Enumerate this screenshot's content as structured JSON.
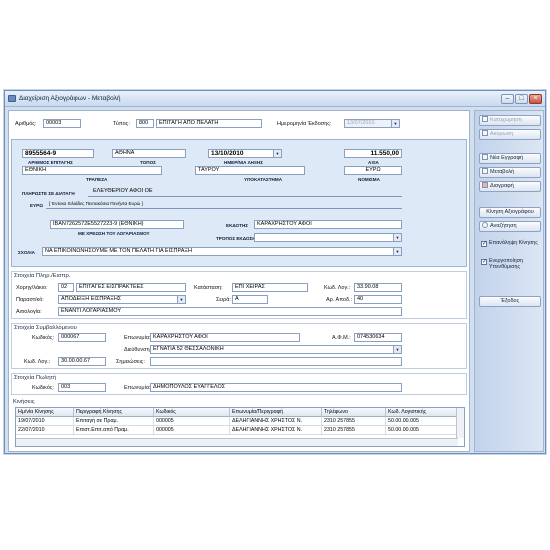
{
  "window": {
    "title": "Διαχείριση Αξιογράφων - Μεταβολή"
  },
  "header": {
    "arithmos_label": "Αριθμός:",
    "arithmos_value": "00003",
    "typos_label": "Τύπος:",
    "typos_code": "800",
    "typos_value": "ΕΠΙΤΑΓΗ ΑΠΟ ΠΕΛΑΤΗ",
    "hmeromhnia_label": "Ημερομηνία Έκδοσης:",
    "hmeromhnia_value": "13/07/2010"
  },
  "cheque": {
    "arithmos_epitaghs": "8955564-9",
    "arithmos_epitaghs_cap": "ΑΡΙΘΜΟΣ ΕΠΙΤΑΓΗΣ",
    "topos": "ΑΘΗΝΑ",
    "topos_cap": "ΤΟΠΟΣ",
    "hmeromhnia_lhxhs": "13/10/2010",
    "hmeromhnia_cap": "ΗΜΕΡ/ΝΙΑ ΛΗΞΗΣ",
    "axia": "11.550,00",
    "axia_cap": "ΑΞΙΑ",
    "trapeza": "ΕΘΝΙΚΗ",
    "trapeza_cap": "ΤΡΑΠΕΖΑ",
    "ypokatasthma": "ΤΑΥΡΟΥ",
    "ypokatasthma_cap": "ΥΠΟΚΑΤΑΣΤΗΜΑ",
    "nomisma": "ΕΥΡΩ",
    "nomisma_cap": "ΝΟΜΙΣΜΑ",
    "plhrwste_cap": "ΠΛΗΡΩΣΤΕ ΣΕ ΔΙΑΤΑΓΗ",
    "plhrwste_value": "ΕΛΕΥΘΕΡΙΟΥ ΑΦΟΙ ΟΕ",
    "eurw_cap": "ΕΥΡΩ",
    "eurw_value": "[ Έντεκα Χιλιάδες Πεντακόσια Πενήντα Ευρώ ]",
    "iban": "IBAN7262572E5527223-9 (ΕΘΝΙΚΗ)",
    "iban_cap": "ΜΕ ΧΡΕΩΣΗ ΤΟΥ ΛΟΓΑΡΙΑΣΜΟΥ",
    "ekdoths_cap": "ΕΚΔΟΤΗΣ",
    "ekdoths_value": "ΚΑΡΑΧΡΗΣΤΟΥ ΑΦΟΙ",
    "tropos_cap": "ΤΡΟΠΟΣ ΕΚΔΟΣΗΣ",
    "tropos_value": "",
    "sxolia_cap": "ΣΧΟΛΙΑ",
    "sxolia_value": "ΝΑ ΕΠΙΚΟΙΝΩΝΗΣΟΥΜΕ ΜΕ ΤΟΝ ΠΕΛΑΤΗ ΓΙΑ ΕΙΣΠΡΑΞΗ"
  },
  "payment": {
    "title": "Στοιχεία Πληρ./Εισπρ.",
    "xrewst_label": "Χορηγ/λάκιο:",
    "xrewst_code": "02",
    "xrewst_value": "ΕΠΙΤΑΓΕΣ ΕΙΣΠΡΑΚΤΕΕΣ",
    "katastash_label": "Κατάσταση:",
    "katastash_value": "ΕΠΙ ΧΕΙΡΑΣ",
    "kwd_log_label": "Κωδ. Λογ.:",
    "kwd_log_value": "33.90.08",
    "parastatiko_label": "Παραστ/κό:",
    "parastatiko_value": "ΑΠΟΔΕΙΞΗ ΕΙΣΠΡΑΞΗΣ",
    "seira_label": "Σειρά:",
    "seira_value": "Α",
    "ar_apod_label": "Αρ. Αποδ.:",
    "ar_apod_value": "40",
    "aitiologia_label": "Αιτιολογία:",
    "aitiologia_value": "ΕΝΑΝΤΙ ΛΟΓΑΡΙΑΣΜΟΥ"
  },
  "counterparty": {
    "title": "Στοιχεία Συμβαλλόμενου",
    "kwdikos_label": "Κωδικός:",
    "kwdikos_value": "000067",
    "eponymia_label": "Επωνυμία:",
    "eponymia_value": "ΚΑΡΑΧΡΗΣΤΟΥ ΑΦΟΙ",
    "afm_label": "Α.Φ.Μ.:",
    "afm_value": "074530634",
    "dieythynsh_label": "Διεύθυνση:",
    "dieythynsh_value": "ΕΓΝΑΤΙΑ 52 ΘΕΣΣΑΛΟΝΙΚΗ",
    "kwd_log_label": "Κωδ. Λογ.:",
    "kwd_log_value": "30.00.00.67",
    "shmeiwseis_label": "Σημειώσεις:",
    "shmeiwseis_value": ""
  },
  "seller": {
    "title": "Στοιχεία Πωλητή",
    "kwdikos_label": "Κωδικός:",
    "kwdikos_value": "003",
    "eponymia_label": "Επωνυμία:",
    "eponymia_value": "ΔΗΜΟΠΟΥΛΟΣ ΕΥΑΓΓΕΛΟΣ"
  },
  "movements": {
    "title": "Κινήσεις",
    "columns": [
      "Ημ/νία Κίνησης",
      "Περιγραφή Κίνησης",
      "Κωδικός",
      "Επωνυμία/Περιγραφή",
      "Τηλέφωνο",
      "Κωδ. Λογιστικής"
    ],
    "rows": [
      [
        "19/07/2010",
        "Επιταγή σε Πραμ.",
        "000005",
        "ΔΕΛΗΓΙΑΝΝΗΣ ΧΡΗΣΤΟΣ Ν.",
        "2310 257855",
        "50.00.00.005"
      ],
      [
        "22/07/2010",
        "Επιστ.Επιτ.από Πραμ.",
        "000005",
        "ΔΕΛΗΓΙΑΝΝΗΣ ΧΡΗΣΤΟΣ Ν.",
        "2310 257855",
        "50.00.00.005"
      ]
    ]
  },
  "sidebar": {
    "katax": "Καταχώρηση",
    "akyrwsh": "Ακύρωση",
    "nea": "Νέα Εγγραφή",
    "metavolh": "Μεταβολή",
    "diagrafh": "Διαγραφή",
    "kinhsh": "Κίνηση Αξιογράφου",
    "anazhthsh": "Αναζήτηση",
    "chk1": "Επανάληψη Κίνησης",
    "chk2": "Ενεργοποίηση Υπενθύμισης",
    "exodos": "Έξοδος"
  }
}
